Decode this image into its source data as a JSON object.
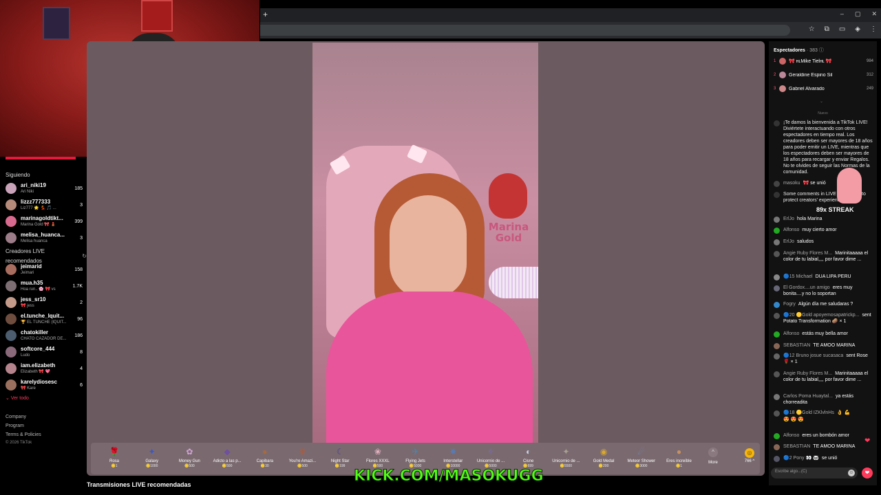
{
  "browser": {
    "new_tab_icon": "+",
    "window_controls": [
      "–",
      "▢",
      "✕"
    ],
    "toolbar_icons": [
      "☆",
      "⧉",
      "▭",
      "◈",
      "⋮"
    ]
  },
  "sidebar": {
    "following_title": "Siguiendo",
    "following": [
      {
        "name": "ari_niki19",
        "sub": "Ari Niki",
        "count": "185",
        "color": "#c7a2b9"
      },
      {
        "name": "lizzz777333",
        "sub": "Liz777 🌟 💃 🎵 ...",
        "count": "3",
        "color": "#b58a7a"
      },
      {
        "name": "marinagoldtikt...",
        "sub": "Marina Gold 🎀 💄",
        "count": "399",
        "color": "#d86a8f"
      },
      {
        "name": "melisa_huanca...",
        "sub": "Melisa huanca",
        "count": "3",
        "color": "#9b7c88"
      }
    ],
    "recommended_title": "Creadores LIVE recomendados",
    "recommended_icon": "refresh-icon",
    "recommended": [
      {
        "name": "jeimarid",
        "sub": "Jeimari",
        "count": "158",
        "color": "#a86d5f"
      },
      {
        "name": "mua.h35",
        "sub": "Hoa run.. 🌸 🎀 vs",
        "count": "1.7K",
        "color": "#7d6e74"
      },
      {
        "name": "jess_sr10",
        "sub": "🎀 jess",
        "count": "2",
        "color": "#c49b8a"
      },
      {
        "name": "el.tunche_lquit...",
        "sub": "🏆 EL TUNCHE (lQUIT...",
        "count": "96",
        "color": "#6e4d3f"
      },
      {
        "name": "chatokiller",
        "sub": "CHATO CAZADOR DE...",
        "count": "186",
        "color": "#4b5d6e"
      },
      {
        "name": "softcore_444",
        "sub": "Ludo",
        "count": "8",
        "color": "#8a6a7a"
      },
      {
        "name": "iam.elizabeth",
        "sub": "Elizabeth 🎀 💖",
        "count": "4",
        "color": "#b4838b"
      },
      {
        "name": "karelydiosesc",
        "sub": "🎀 Kare",
        "count": "6",
        "color": "#9a6f5d"
      }
    ],
    "see_all": "⌄ Ver todo",
    "footer": [
      "Company",
      "Program",
      "Terms & Policies"
    ],
    "copyright": "© 2026 TikTok"
  },
  "stage": {
    "logo_text": "Marina Gold",
    "recommended_live_title": "Transmisiones LIVE recomendadas"
  },
  "gifts": [
    {
      "name": "Rosa",
      "cost": "🪙1",
      "icon": "🌹",
      "color": "#c0394b"
    },
    {
      "name": "Galaxy",
      "cost": "🪙1000",
      "icon": "✦",
      "color": "#3a58c8"
    },
    {
      "name": "Money Gun",
      "cost": "🪙500",
      "icon": "✿",
      "color": "#d4a3d8"
    },
    {
      "name": "Adicto a las p...",
      "cost": "🪙500",
      "icon": "◆",
      "color": "#6e4fa0"
    },
    {
      "name": "Capibara",
      "cost": "🪙30",
      "icon": "●",
      "color": "#a86a3a"
    },
    {
      "name": "You're Amazi...",
      "cost": "🪙500",
      "icon": "♛",
      "color": "#b05a3a"
    },
    {
      "name": "Night Star",
      "cost": "🪙199",
      "icon": "☾",
      "color": "#4a3a90"
    },
    {
      "name": "Flores XXXL",
      "cost": "🪙500",
      "icon": "❀",
      "color": "#e5b2c0"
    },
    {
      "name": "Flying Jets",
      "cost": "🪙5000",
      "icon": "✈",
      "color": "#3a8ab8"
    },
    {
      "name": "Interstellar",
      "cost": "🪙10000",
      "icon": "✸",
      "color": "#5a7ab0"
    },
    {
      "name": "Unicornio de ...",
      "cost": "🪙5000",
      "icon": "✧",
      "color": "#7a6ab8"
    },
    {
      "name": "Cisne",
      "cost": "🪙699",
      "icon": "◐",
      "color": "#c8d8e8"
    },
    {
      "name": "Unicornio de ...",
      "cost": "🪙5500",
      "icon": "✦",
      "color": "#a8a090"
    },
    {
      "name": "Gold Medal",
      "cost": "🪙200",
      "icon": "◉",
      "color": "#d8a830"
    },
    {
      "name": "Meteor Shower",
      "cost": "🪙3000",
      "icon": "☄",
      "color": "#6a8ab0"
    },
    {
      "name": "Eres increíble",
      "cost": "🪙1",
      "icon": "●",
      "color": "#c89060"
    }
  ],
  "gift_more": {
    "icon": "^",
    "label": "More"
  },
  "coins": {
    "icon": "◎",
    "count": "766 ^"
  },
  "overlay": {
    "kick_text": "KICK.COM/MASOKUGG",
    "streak_text": "89x STREAK"
  },
  "chat": {
    "viewers_label": "Espectadores",
    "viewers_sep": "·",
    "viewers_count": "383",
    "viewers_info_icon": "ⓘ",
    "top_viewers": [
      {
        "rank": "1",
        "name": "🎀 ʜʟMike Tielʜʟ 🎀",
        "score": "984",
        "color": "#c66"
      },
      {
        "rank": "2",
        "name": "Geraldine Espino Sil",
        "score": "312",
        "color": "#b89"
      },
      {
        "rank": "3",
        "name": "Gabriel Alvarado",
        "score": "249",
        "color": "#c88"
      }
    ],
    "collapse_icon": "⌄",
    "divider_label": "Nuevo",
    "messages": [
      {
        "user": "",
        "text": "¡Te damos la bienvenida a TikTok LIVE! Diviértete interactuando con otros espectadores en tiempo real. Los creadores deben ser mayores de 18 años para poder emitir un LIVE, mientras que los espectadores deben ser mayores de 18 años para recargar y enviar Regalos. No te olvides de seguir las Normas de la comunidad.",
        "color": "#333"
      },
      {
        "user": "masoku",
        "text": "🎀 se unió",
        "color": "#444"
      },
      {
        "user": "",
        "text": "Some comments in LIVE are filtered to protect creators' experience.",
        "color": "#333"
      },
      {
        "user": "ErlJo",
        "text": "hola Marina",
        "color": "#777"
      },
      {
        "user": "Alfonso",
        "text": "muy cierto amor",
        "color": "#2a2"
      },
      {
        "user": "ErlJo",
        "text": "saludos",
        "color": "#777"
      },
      {
        "user": "Angie Ruby Flores M...",
        "text": "Marinitaaaaa el color de tu labial,,,, por favor dime ...",
        "color": "#555"
      },
      {
        "user": "🔵15 Michael",
        "text": "DUA LIPA PERU",
        "color": "#888"
      },
      {
        "user": "El Gordox....un amigo",
        "text": "eres muy bonita....y no lo soportan",
        "color": "#667"
      },
      {
        "user": "Fogry",
        "text": "Algún día me saludaras ?",
        "color": "#38c"
      },
      {
        "user": "🔵20 🟡Gold apoyemosapatrickp...",
        "text": "sent Potato Transformation 🥔 × 1",
        "color": "#555"
      },
      {
        "user": "Alfonso",
        "text": "estás muy bella amor",
        "color": "#2a2"
      },
      {
        "user": "SEBASTIAN",
        "text": "TE AMOO MARINA",
        "color": "#865"
      },
      {
        "user": "🔵12 Bruno josue sucasaca",
        "text": "sent Rose 🌹 × 1",
        "color": "#666"
      },
      {
        "user": "Angie Ruby Flores M...",
        "text": "Marinitaaaaa el color de tu labial,,,, por favor dime ...",
        "color": "#555"
      },
      {
        "user": "Carlos Poma Huaytal...",
        "text": "ya estás chorreadita",
        "color": "#777"
      },
      {
        "user": "🔵18 🟡Gold IZKlvlnHs",
        "text": "👌 💪",
        "color": "#555"
      },
      {
        "user": "",
        "text": "😍 😍 😍",
        "color": "#121212"
      },
      {
        "user": "Alfonso",
        "text": "eres un bombón amor",
        "color": "#2a2"
      },
      {
        "user": "SEBASTIAN",
        "text": "TE AMOO MARINA",
        "color": "#865"
      },
      {
        "user": "🔵2 Pony 👀 🐼",
        "text": "se unió",
        "color": "#556"
      }
    ],
    "input_placeholder": "Escribe algo...(C)",
    "emoji_icon": "☺",
    "like_icon": "❤"
  }
}
